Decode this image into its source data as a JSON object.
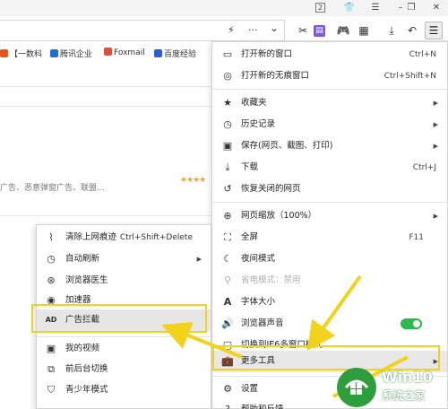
{
  "titlebar": {
    "tab_count": "2"
  },
  "address_bar": {
    "flash_icon": "⚡",
    "more_icon": "···",
    "dropdown_icon": "⌄"
  },
  "bookmarks": [
    {
      "label": "【一数科",
      "color": "#e8541c"
    },
    {
      "label": "腾讯企业",
      "color": "#1a6fd8"
    },
    {
      "label": "Foxmail",
      "color": "#e84a3a"
    },
    {
      "label": "百度经验",
      "color": "#2a5fdb"
    }
  ],
  "page": {
    "snippet": "广告、恶意弹窗广告、联盟..."
  },
  "main_menu": {
    "items": [
      {
        "label": "打开新的窗口",
        "shortcut": "Ctrl+N",
        "icon": "new-window-icon"
      },
      {
        "label": "打开新的无痕窗口",
        "shortcut": "Ctrl+Shift+N",
        "icon": "incognito-icon"
      },
      {
        "label": "收藏夹",
        "icon": "favorites-icon"
      },
      {
        "label": "历史记录",
        "icon": "history-icon"
      },
      {
        "label": "保存(网页、截图、打印)",
        "icon": "save-icon"
      },
      {
        "label": "下载",
        "shortcut": "Ctrl+J",
        "icon": "download-icon"
      },
      {
        "label": "恢复关闭的网页",
        "icon": "restore-icon"
      },
      {
        "label": "网页缩放（100%）",
        "icon": "zoom-icon"
      },
      {
        "label": "全屏",
        "shortcut": "F11",
        "icon": "fullscreen-icon"
      },
      {
        "label": "夜间模式",
        "icon": "night-mode-icon"
      },
      {
        "label": "省电模式：禁用",
        "icon": "power-save-icon"
      },
      {
        "label": "字体大小",
        "icon": "font-size-icon"
      },
      {
        "label": "浏览器声音",
        "icon": "sound-icon"
      },
      {
        "label": "切换到IE6多窗口模式",
        "icon": "ie6-mode-icon"
      },
      {
        "label": "更多工具",
        "icon": "more-tools-icon"
      },
      {
        "label": "设置",
        "icon": "settings-icon"
      },
      {
        "label": "帮助和反馈",
        "icon": "help-icon"
      }
    ]
  },
  "sub_menu": {
    "items": [
      {
        "label": "清除上网痕迹",
        "shortcut": "Ctrl+Shift+Delete",
        "icon": "broom-icon"
      },
      {
        "label": "自动刷新",
        "icon": "auto-refresh-icon"
      },
      {
        "label": "浏览器医生",
        "icon": "doctor-icon"
      },
      {
        "label": "加速器",
        "icon": "accelerator-icon"
      },
      {
        "label": "广告拦截",
        "icon": "ad-block-icon"
      },
      {
        "label": "我的视频",
        "icon": "video-icon"
      },
      {
        "label": "前后台切换",
        "icon": "switch-icon"
      },
      {
        "label": "青少年模式",
        "icon": "teen-mode-icon"
      }
    ]
  },
  "watermark": {
    "line1": "Win10",
    "line2": "系统之家"
  },
  "colors": {
    "highlight": "#f2d21a",
    "toggle_on": "#2db84d"
  }
}
